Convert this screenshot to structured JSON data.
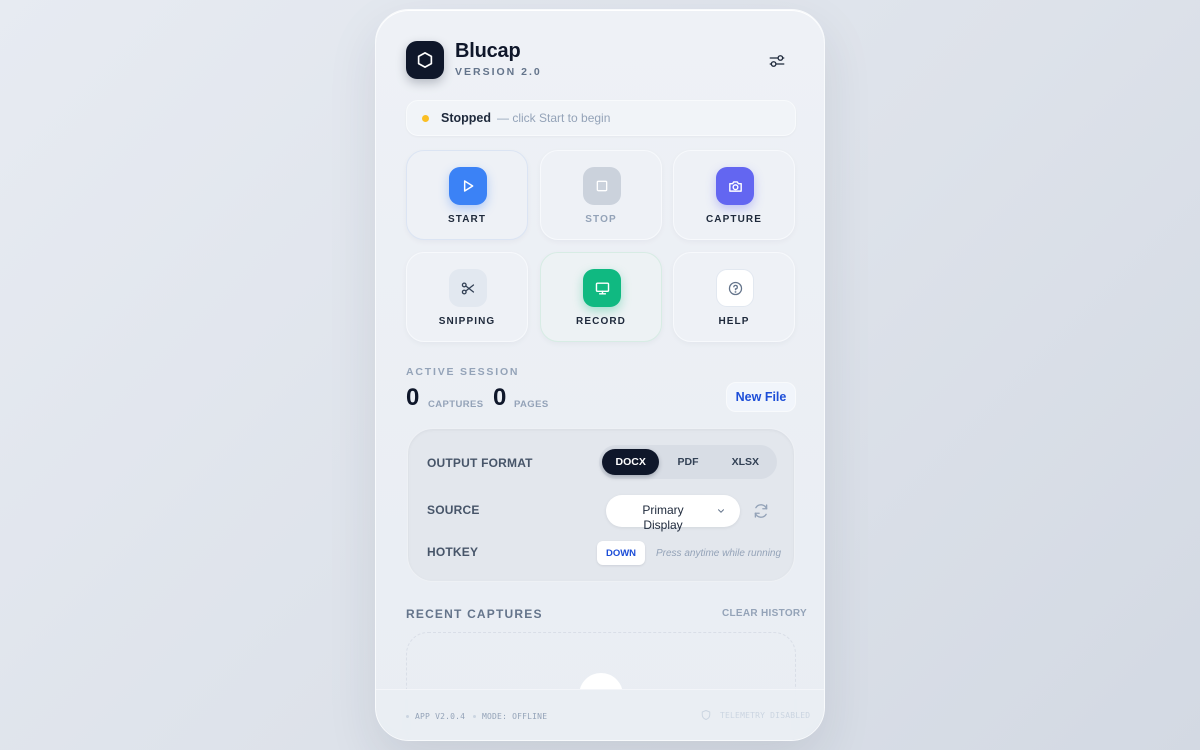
{
  "app": {
    "title": "Blucap",
    "version": "VERSION 2.0"
  },
  "status": {
    "label": "Stopped",
    "hint": "— click Start to begin",
    "dot_color": "#fbbf24"
  },
  "actions": [
    {
      "label": "START",
      "icon": "play-icon",
      "color": "#3b82f6"
    },
    {
      "label": "STOP",
      "icon": "stop-icon",
      "color": "#cbd2dc",
      "disabled": true
    },
    {
      "label": "CAPTURE",
      "icon": "camera-icon",
      "color": "#6366f1"
    },
    {
      "label": "SNIPPING",
      "icon": "scissors-icon",
      "color": "#e2e8f0"
    },
    {
      "label": "RECORD",
      "icon": "monitor-icon",
      "color": "#10b981"
    },
    {
      "label": "HELP",
      "icon": "help-icon",
      "color": "#ffffff"
    }
  ],
  "session": {
    "label": "ACTIVE SESSION",
    "captures_count": "0",
    "captures_unit": "CAPTURES",
    "pages_count": "0",
    "pages_unit": "PAGES",
    "new_file_label": "New File"
  },
  "settings": {
    "output_format_label": "OUTPUT FORMAT",
    "formats": [
      "DOCX",
      "PDF",
      "XLSX"
    ],
    "selected_format": "DOCX",
    "source_label": "SOURCE",
    "source_value": "Primary Display",
    "hotkey_label": "HOTKEY",
    "hotkey_value": "DOWN",
    "hotkey_hint": "Press anytime while running"
  },
  "recent": {
    "label": "RECENT CAPTURES",
    "clear_label": "CLEAR HISTORY"
  },
  "footer": {
    "app_version": "APP V2.0.4",
    "mode": "MODE: OFFLINE",
    "telemetry": "TELEMETRY DISABLED"
  }
}
